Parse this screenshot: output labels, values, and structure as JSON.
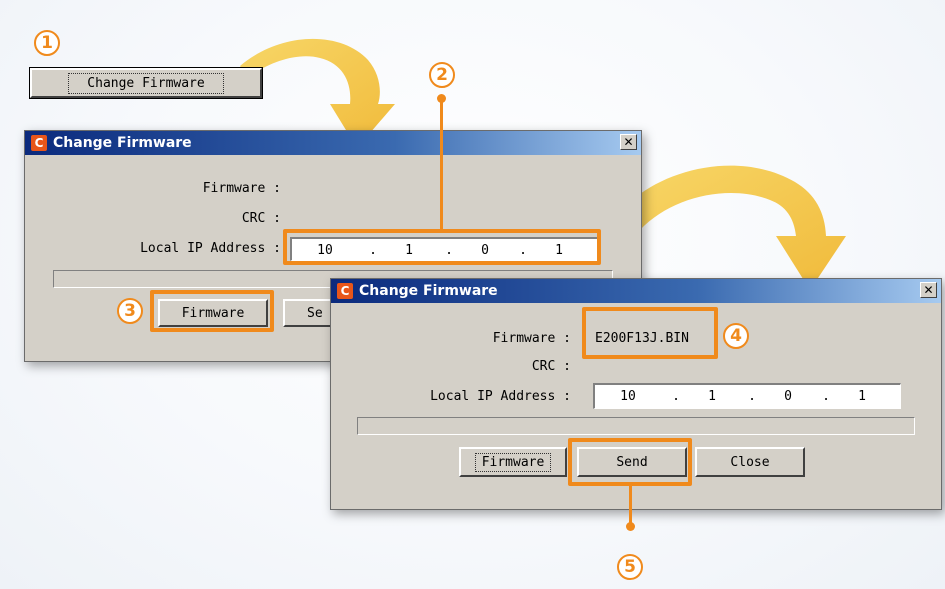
{
  "callouts": [
    "1",
    "2",
    "3",
    "4",
    "5"
  ],
  "top_button": {
    "label": "Change Firmware"
  },
  "dialog1": {
    "title": "Change Firmware",
    "close_glyph": "✕",
    "firmware_label": "Firmware :",
    "crc_label": "CRC :",
    "ip_label": "Local IP Address :",
    "ip": [
      "10",
      "1",
      "0",
      "1"
    ],
    "firmware_button": "Firmware",
    "send_button_partial": "Se"
  },
  "dialog2": {
    "title": "Change Firmware",
    "close_glyph": "✕",
    "firmware_label": "Firmware :",
    "firmware_value": "E200F13J.BIN",
    "crc_label": "CRC :",
    "ip_label": "Local IP Address :",
    "ip": [
      "10",
      "1",
      "0",
      "1"
    ],
    "firmware_button": "Firmware",
    "send_button": "Send",
    "close_button": "Close"
  },
  "colors": {
    "accent": "#f08a1c",
    "arrow": "#f2c43a",
    "titlebar": "#0b2a7d",
    "dialog_bg": "#d4d0c8"
  }
}
